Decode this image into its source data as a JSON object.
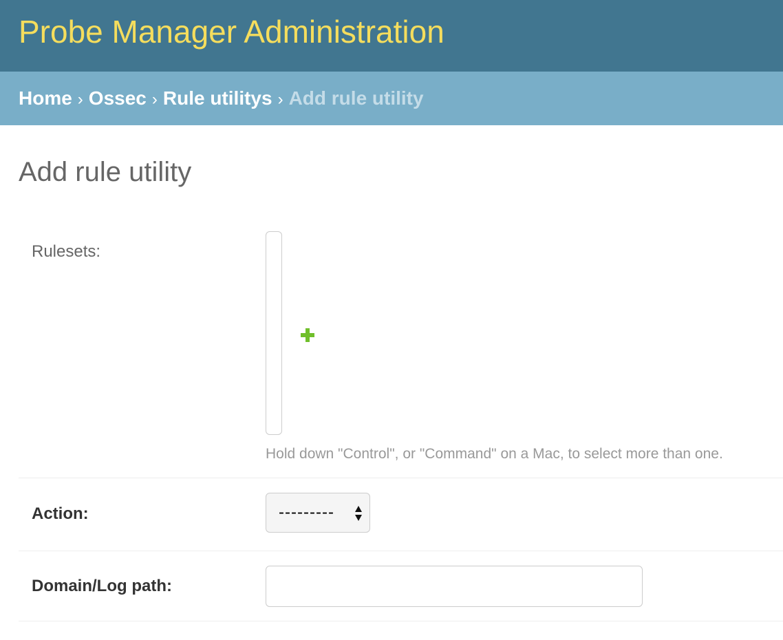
{
  "header": {
    "site_name": "Probe Manager Administration"
  },
  "breadcrumbs": {
    "items": [
      "Home",
      "Ossec",
      "Rule utilitys"
    ],
    "separator": "›",
    "current": "Add rule utility"
  },
  "page": {
    "title": "Add rule utility"
  },
  "form": {
    "rulesets": {
      "label": "Rulesets:",
      "options": [],
      "add_icon": "plus-icon",
      "help_text": "Hold down \"Control\", or \"Command\" on a Mac, to select more than one."
    },
    "action": {
      "label": "Action:",
      "selected": "---------",
      "icon": "select-arrows-icon"
    },
    "domain_log_path": {
      "label": "Domain/Log path:",
      "value": "",
      "placeholder": ""
    }
  },
  "colors": {
    "header_bg": "#417690",
    "site_name": "#f5dd5d",
    "breadcrumbs_bg": "#79aec8",
    "add_icon": "#70bf2b"
  }
}
